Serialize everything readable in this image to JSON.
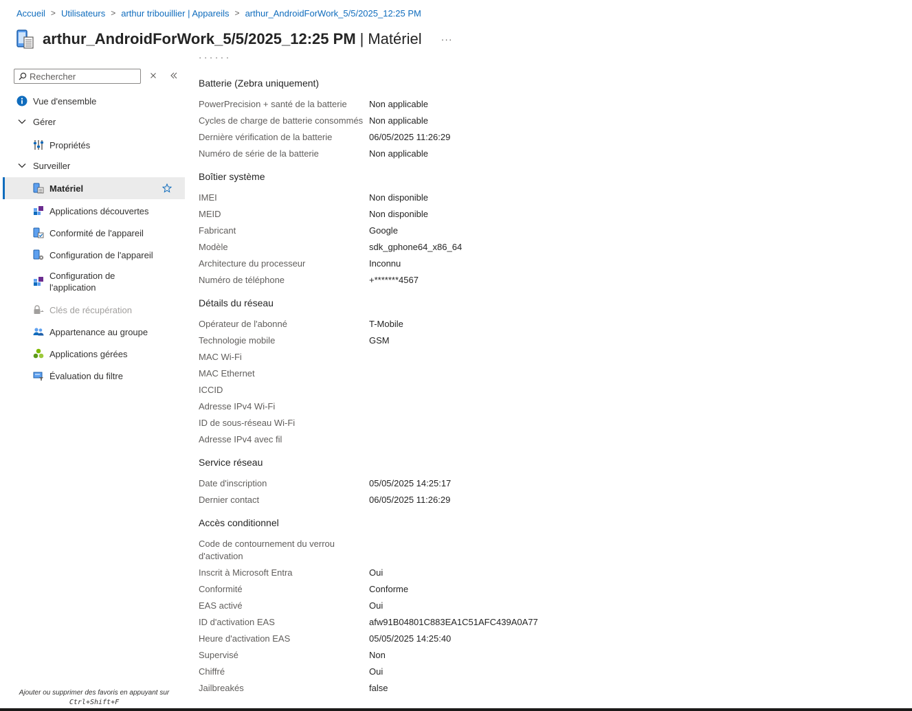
{
  "breadcrumb": {
    "items": [
      "Accueil",
      "Utilisateurs",
      "arthur tribouillier | Appareils",
      "arthur_AndroidForWork_5/5/2025_12:25 PM"
    ]
  },
  "header": {
    "title": "arthur_AndroidForWork_5/5/2025_12:25 PM",
    "separator": "|",
    "subtitle": "Matériel",
    "more": "···"
  },
  "sidebar": {
    "search_placeholder": "Rechercher",
    "items": [
      {
        "label": "Vue d'ensemble",
        "icon": "info-icon"
      },
      {
        "label": "Gérer",
        "icon": "chevron-down-icon"
      },
      {
        "label": "Propriétés",
        "icon": "properties-icon"
      },
      {
        "label": "Surveiller",
        "icon": "chevron-down-icon"
      },
      {
        "label": "Matériel",
        "icon": "device-hardware-icon"
      },
      {
        "label": "Applications découvertes",
        "icon": "apps-icon"
      },
      {
        "label": "Conformité de l'appareil",
        "icon": "device-compliance-icon"
      },
      {
        "label": "Configuration de l'appareil",
        "icon": "device-config-icon"
      },
      {
        "label": "Configuration de l'application",
        "icon": "app-config-icon"
      },
      {
        "label": "Clés de récupération",
        "icon": "recovery-key-icon"
      },
      {
        "label": "Appartenance au groupe",
        "icon": "group-icon"
      },
      {
        "label": "Applications gérées",
        "icon": "managed-apps-icon"
      },
      {
        "label": "Évaluation du filtre",
        "icon": "filter-eval-icon"
      }
    ],
    "footer_hint": "Ajouter ou supprimer des favoris en appuyant sur",
    "footer_shortcut": "Ctrl+Shift+F"
  },
  "content": {
    "cut_text": "· · ·  · ·  ·",
    "sections": [
      {
        "title": "Batterie (Zebra uniquement)",
        "rows": [
          {
            "label": "PowerPrecision + santé de la batterie",
            "value": "Non applicable"
          },
          {
            "label": "Cycles de charge de batterie consommés",
            "value": "Non applicable"
          },
          {
            "label": "Dernière vérification de la batterie",
            "value": "06/05/2025 11:26:29"
          },
          {
            "label": "Numéro de série de la batterie",
            "value": "Non applicable"
          }
        ]
      },
      {
        "title": "Boîtier système",
        "rows": [
          {
            "label": "IMEI",
            "value": "Non disponible"
          },
          {
            "label": "MEID",
            "value": "Non disponible"
          },
          {
            "label": "Fabricant",
            "value": "Google"
          },
          {
            "label": "Modèle",
            "value": "sdk_gphone64_x86_64"
          },
          {
            "label": "Architecture du processeur",
            "value": "Inconnu"
          },
          {
            "label": "Numéro de téléphone",
            "value": "+*******4567"
          }
        ]
      },
      {
        "title": "Détails du réseau",
        "rows": [
          {
            "label": "Opérateur de l'abonné",
            "value": "T-Mobile"
          },
          {
            "label": "Technologie mobile",
            "value": "GSM"
          },
          {
            "label": "MAC Wi-Fi",
            "value": ""
          },
          {
            "label": "MAC Ethernet",
            "value": ""
          },
          {
            "label": "ICCID",
            "value": ""
          },
          {
            "label": "Adresse IPv4 Wi-Fi",
            "value": ""
          },
          {
            "label": "ID de sous-réseau Wi-Fi",
            "value": ""
          },
          {
            "label": "Adresse IPv4 avec fil",
            "value": ""
          }
        ]
      },
      {
        "title": "Service réseau",
        "rows": [
          {
            "label": "Date d'inscription",
            "value": "05/05/2025 14:25:17"
          },
          {
            "label": "Dernier contact",
            "value": "06/05/2025 11:26:29"
          }
        ]
      },
      {
        "title": "Accès conditionnel",
        "rows": [
          {
            "label": "Code de contournement du verrou d'activation",
            "value": ""
          },
          {
            "label": "Inscrit à Microsoft Entra",
            "value": "Oui"
          },
          {
            "label": "Conformité",
            "value": "Conforme"
          },
          {
            "label": "EAS activé",
            "value": "Oui"
          },
          {
            "label": "ID d'activation EAS",
            "value": "afw91B04801C883EA1C51AFC439A0A77"
          },
          {
            "label": "Heure d'activation EAS",
            "value": "05/05/2025 14:25:40"
          },
          {
            "label": "Supervisé",
            "value": "Non"
          },
          {
            "label": "Chiffré",
            "value": "Oui"
          },
          {
            "label": "Jailbreakés",
            "value": "false"
          }
        ]
      }
    ]
  },
  "colors": {
    "link": "#0f6cbd",
    "selected_bg": "#ebebeb",
    "label": "#605e5c",
    "value": "#242424"
  }
}
